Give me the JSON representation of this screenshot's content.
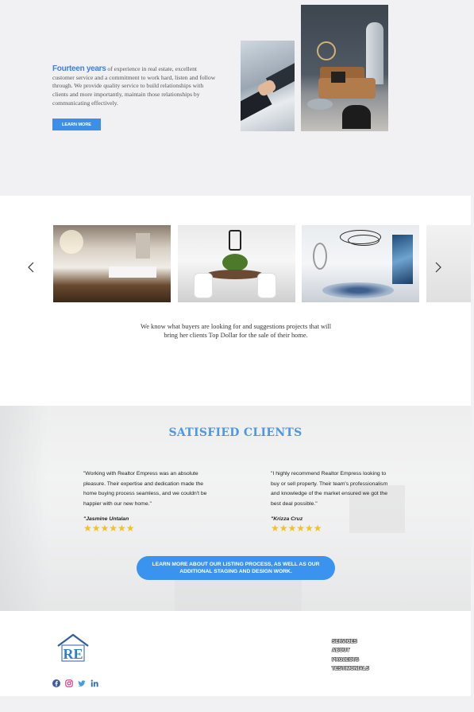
{
  "intro": {
    "highlight": "Fourteen years",
    "text": " of experience in real estate, excellent customer service and a commitment to work hard, listen and follow through. We provide quality service to build relationships with clients and more importantly, maintain those relationships by communicating effectively.",
    "button_label": "LEARN MORE"
  },
  "carousel": {
    "text": "We know what buyers are looking for and suggestions projects that will bring her clients Top Dollar for the sale of their home."
  },
  "testimonials": {
    "title": "SATISFIED CLIENTS",
    "reviews": [
      {
        "quote": "\"Working with Realtor Empress was an absolute pleasure. Their expertise and dedication made the home buying process seamless, and we couldn't be happier with our new home.\"",
        "author": "\"Jasmine Untalan",
        "stars": "★★★★★★",
        "rating": 6
      },
      {
        "quote": "\"I highly recommend Realtor Empress looking to buy or sell property. Their team's professionalism and knowledge of the market ensured we got the best deal possible.\"",
        "author": "\"Krizza Cruz",
        "stars": "★★★★★★",
        "rating": 6
      }
    ],
    "cta_label": "LEARN MORE ABOUT OUR LISTING PROCESS, AS WELL AS OUR ADDITIONAL STAGING AND DESIGN WORK."
  },
  "footer": {
    "logo_text": "RE",
    "nav": [
      "SERVICES",
      "ABOUT",
      "PROJECTS",
      "TESTIMONIALS"
    ],
    "social_icons": [
      "facebook-icon",
      "instagram-icon",
      "twitter-icon",
      "linkedin-icon"
    ]
  },
  "colors": {
    "accent": "#3b8fe6",
    "title_blue": "#4d97e4",
    "star": "#f3c21f",
    "instagram": "#d6297a"
  }
}
